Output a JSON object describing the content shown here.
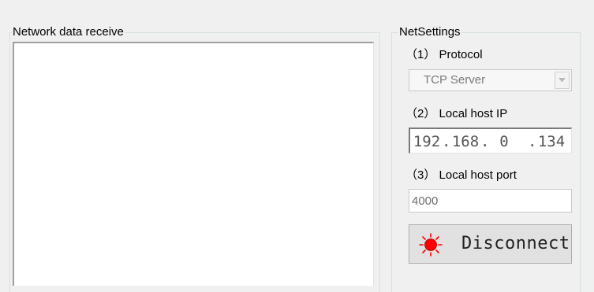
{
  "receive_panel": {
    "title": "Network data receive",
    "content": ""
  },
  "net_settings": {
    "title": "NetSettings",
    "protocol": {
      "label": "（1） Protocol",
      "selected": "TCP Server",
      "arrow_icon": "chevron-down-icon"
    },
    "local_ip": {
      "label": "（2） Local host IP",
      "octets": [
        "192",
        "168",
        "0",
        "134"
      ]
    },
    "local_port": {
      "label": "（3） Local host port",
      "value": "4000"
    },
    "disconnect_button": {
      "label": "Disconnect",
      "icon": "red-led-icon",
      "led_color": "#ff0000"
    }
  }
}
